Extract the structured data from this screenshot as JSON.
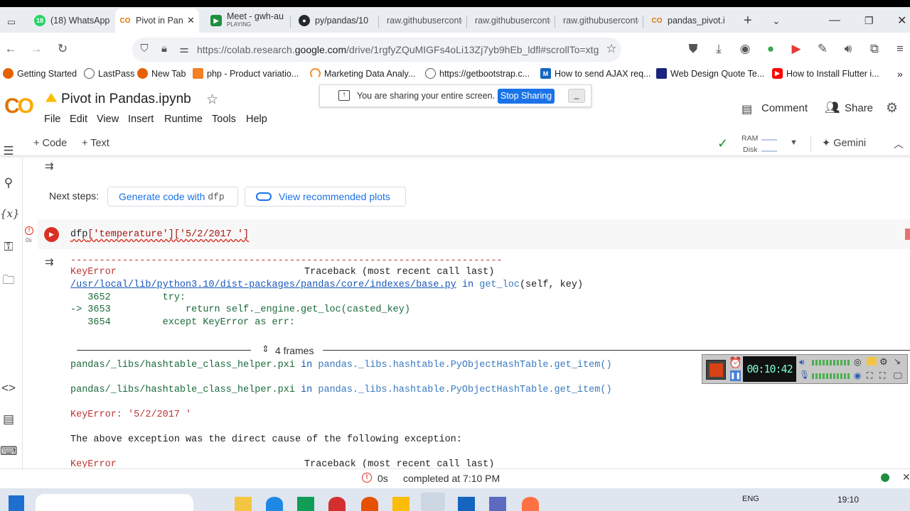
{
  "browser": {
    "tabs": [
      {
        "label": "(18) WhatsApp",
        "color": "#25d366",
        "glyph": "18"
      },
      {
        "label": "Pivot in Pan",
        "color": "#e37400",
        "glyph": "CO"
      },
      {
        "label": "Meet - gwh-au",
        "sub": "PLAYING",
        "color": "#1e8e3e",
        "glyph": "M"
      },
      {
        "label": "py/pandas/10",
        "color": "#24292e",
        "glyph": "GH"
      },
      {
        "label": "raw.githubuserconte",
        "color": "",
        "glyph": ""
      },
      {
        "label": "raw.githubuserconte",
        "color": "",
        "glyph": ""
      },
      {
        "label": "raw.githubuserconte",
        "color": "",
        "glyph": ""
      },
      {
        "label": "pandas_pivot.i",
        "color": "#e37400",
        "glyph": "CO"
      }
    ],
    "url": {
      "prefix": "https://colab.research.",
      "domain": "google.com",
      "rest": "/drive/1rgfyZQuMIGFs4oLi13Zj7yb9hEb_ldfl#scrollTo=xtg"
    },
    "bookmarks": [
      {
        "label": "Getting Started",
        "color": "#e66000"
      },
      {
        "label": "LastPass",
        "color": "#555555"
      },
      {
        "label": "New Tab",
        "color": "#e66000"
      },
      {
        "label": "php - Product variatio...",
        "color": "#f48024"
      },
      {
        "label": "Marketing Data Analy...",
        "color": "#f28c28"
      },
      {
        "label": "https://getbootstrap.c...",
        "color": "#555555"
      },
      {
        "label": "How to send AJAX req...",
        "color": "#1565c0"
      },
      {
        "label": "Web Design Quote Te...",
        "color": "#1a237e"
      },
      {
        "label": "How to Install Flutter i...",
        "color": "#ff0000"
      }
    ]
  },
  "colab": {
    "logo": "CO",
    "notebook_title": "Pivot in Pandas.ipynb",
    "menus": [
      "File",
      "Edit",
      "View",
      "Insert",
      "Runtime",
      "Tools",
      "Help"
    ],
    "share_banner": {
      "text": "You are sharing your entire screen.",
      "button": "Stop Sharing"
    },
    "comment": "Comment",
    "share": "Share",
    "toolbar": {
      "code": "Code",
      "text": "Text",
      "ram": "RAM",
      "disk": "Disk",
      "gemini": "Gemini"
    },
    "next_steps": {
      "label": "Next steps:",
      "btn1_prefix": "Generate code with",
      "btn1_var": "dfp",
      "btn2": "View recommended plots"
    },
    "cell": {
      "exec_time": "0s",
      "code_pre": "dfp",
      "code_rest": "['temperature']['5/2/2017 ']"
    },
    "output": {
      "dashes": "---------------------------------------------------------------------------",
      "error_name": "KeyError",
      "traceback_header": "Traceback (most recent call last)",
      "file_link": "/usr/local/lib/python3.10/dist-packages/pandas/core/indexes/base.py",
      "in_word": "in",
      "func": "get_loc",
      "func_args": "(self, key)",
      "lines": [
        "   3652         try:",
        "-> 3653             return self._engine.get_loc(casted_key)",
        "   3654         except KeyError as err:"
      ],
      "frames": "4 frames",
      "frame_file": "pandas/_libs/hashtable_class_helper.pxi",
      "frame_func": "pandas._libs.hashtable.PyObjectHashTable.get_item()",
      "error_line": "KeyError: '5/2/2017 '",
      "cause": "The above exception was the direct cause of the following exception:",
      "error_name2": "KeyError",
      "traceback_header2": "Traceback (most recent call last)"
    },
    "status": {
      "time": "0s",
      "text": "completed at 7:10 PM"
    }
  },
  "recorder": {
    "time": "00:10:42"
  },
  "taskbar": {
    "lang": "ENG",
    "clock": "19:10"
  }
}
